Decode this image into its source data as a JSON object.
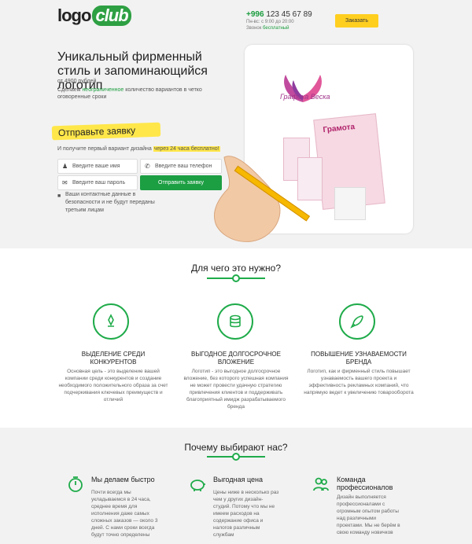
{
  "header": {
    "logo_main": "logo",
    "logo_club": "club",
    "phone_code": "+996",
    "phone_number": "123 45 67 89",
    "hours": "Пн-вс: с 9:00 до 20:00",
    "call_prefix": "Звонок",
    "call_free": "бесплатный",
    "order_button": "Заказать"
  },
  "hero": {
    "title": "Уникальный фирменный стиль и запоминающийся логотип",
    "price": "от 4900 рублей",
    "desc_prefix": "Сделаем",
    "desc_highlight": "неограниченное",
    "desc_suffix": "количество вариантов в четко оговоренные сроки",
    "form_title": "Отправьте заявку",
    "form_note_prefix": "И получите первый вариант дизайна",
    "form_note_highlight": "через 24 часа бесплатно!",
    "name_placeholder": "Введите ваше имя",
    "phone_placeholder": "Введите ваш телефон",
    "password_placeholder": "Введите ваш пароль",
    "submit": "Отправить заявку",
    "privacy": "Ваши контактные данные в безопасности и не будут переданы третьим лицам",
    "brand_label": "Графика Веска",
    "card_title": "Грамота"
  },
  "why": {
    "title": "Для чего это нужно?",
    "features": [
      {
        "icon": "award-icon",
        "title": "ВЫДЕЛЕНИЕ СРЕДИ КОНКУРЕНТОВ",
        "text": "Основная цель - это выделение вашей компании среди конкурентов и создание необходимого положительного образа за счет подчеркивания ключевых преимуществ и отличий"
      },
      {
        "icon": "coins-icon",
        "title": "ВЫГОДНОЕ ДОЛГОСРОЧНОЕ ВЛОЖЕНИЕ",
        "text": "Логотип - это выгодное долгосрочное вложение, без которого успешная компания не может провести удачную стратегию привлечения клиентов и поддерживать благоприятный имидж разрабатываемого бренда"
      },
      {
        "icon": "rocket-icon",
        "title": "ПОВЫШЕНИЕ УЗНАВАЕМОСТИ БРЕНДА",
        "text": "Логотип, как и фирменный стиль повышает узнаваемость вашего проекта и эффективность рекламных компаний, что напрямую ведет к увеличению товарооборота"
      }
    ]
  },
  "choose": {
    "title": "Почему выбирают нас?",
    "items": [
      {
        "icon": "stopwatch-icon",
        "title": "Мы делаем быстро",
        "text": "Почти всегда мы укладываемся в 24 часа, среднее время для исполнения даже самых сложных заказов — около 3 дней. С нами сроки всегда будут точно определены"
      },
      {
        "icon": "piggy-bank-icon",
        "title": "Выгодная цена",
        "text": "Цены ниже в несколько раз чем у других дизайн-студий. Потому что мы не имеем расходов на содержание офиса и налогов различным службам"
      },
      {
        "icon": "team-icon",
        "title": "Команда профессионалов",
        "text": "Дизайн выполняется профессионалами с огромным опытом работы над различными проектами. Мы не берём в свою команду новичков"
      }
    ]
  },
  "colors": {
    "accent": "#1fab4a",
    "yellow": "#ffcf20",
    "highlight": "#ffe74a"
  }
}
